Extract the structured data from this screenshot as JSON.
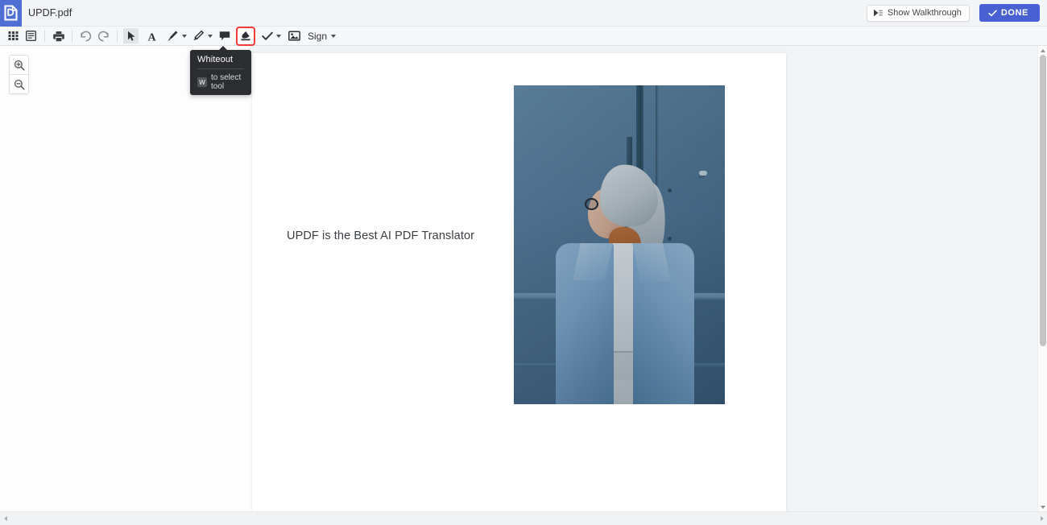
{
  "titlebar": {
    "logo_icon": "updf-document-logo-icon",
    "document_title": "UPDF.pdf",
    "walkthrough_label": "Show Walkthrough",
    "walkthrough_icon": "walkthrough-flag-icon",
    "done_label": "DONE",
    "done_icon": "check-icon",
    "done_color": "#4860d2"
  },
  "toolbar": {
    "items": [
      {
        "name": "thumbnails-grid-button",
        "icon": "grid-icon",
        "label": ""
      },
      {
        "name": "page-list-button",
        "icon": "list-panel-icon",
        "label": ""
      },
      {
        "name": "print-button",
        "icon": "printer-icon",
        "label": ""
      },
      {
        "name": "undo-button",
        "icon": "undo-arrow-icon",
        "label": ""
      },
      {
        "name": "redo-button",
        "icon": "redo-arrow-icon",
        "label": ""
      },
      {
        "name": "select-tool-button",
        "icon": "cursor-arrow-icon",
        "label": ""
      },
      {
        "name": "text-tool-button",
        "icon": "text-a-icon",
        "label": ""
      },
      {
        "name": "highlight-tool-button",
        "icon": "marker-pen-icon",
        "label": ""
      },
      {
        "name": "pencil-tool-button",
        "icon": "pencil-icon",
        "label": ""
      },
      {
        "name": "sticky-note-button",
        "icon": "comment-bubble-icon",
        "label": ""
      },
      {
        "name": "whiteout-tool-button",
        "icon": "whiteout-bucket-icon",
        "label": ""
      },
      {
        "name": "stamp-check-button",
        "icon": "check-mark-icon",
        "label": ""
      },
      {
        "name": "image-tool-button",
        "icon": "picture-icon",
        "label": ""
      },
      {
        "name": "sign-menu-button",
        "icon": "chevron-down-icon",
        "label": "Sign"
      }
    ],
    "sign_label": "Sign",
    "active_tool": "select-tool-button",
    "highlighted_tool": "whiteout-tool-button",
    "highlight_color": "#ef3b3b"
  },
  "tooltip": {
    "title": "Whiteout",
    "shortcut_key": "W",
    "shortcut_text": "to select tool",
    "background": "#2b2d30"
  },
  "sidepane": {
    "zoom_in": {
      "name": "zoom-in-button",
      "icon": "magnifier-plus-icon"
    },
    "zoom_out": {
      "name": "zoom-out-button",
      "icon": "magnifier-minus-icon"
    }
  },
  "document": {
    "page_text": "UPDF is the Best AI PDF Translator",
    "image_alt": "woman-in-denim-jacket-photo"
  },
  "scrollbars": {
    "vertical_up_icon": "scroll-up-arrow-icon",
    "vertical_down_icon": "scroll-down-arrow-icon",
    "horizontal_left_icon": "scroll-left-arrow-icon",
    "horizontal_right_icon": "scroll-right-arrow-icon"
  }
}
